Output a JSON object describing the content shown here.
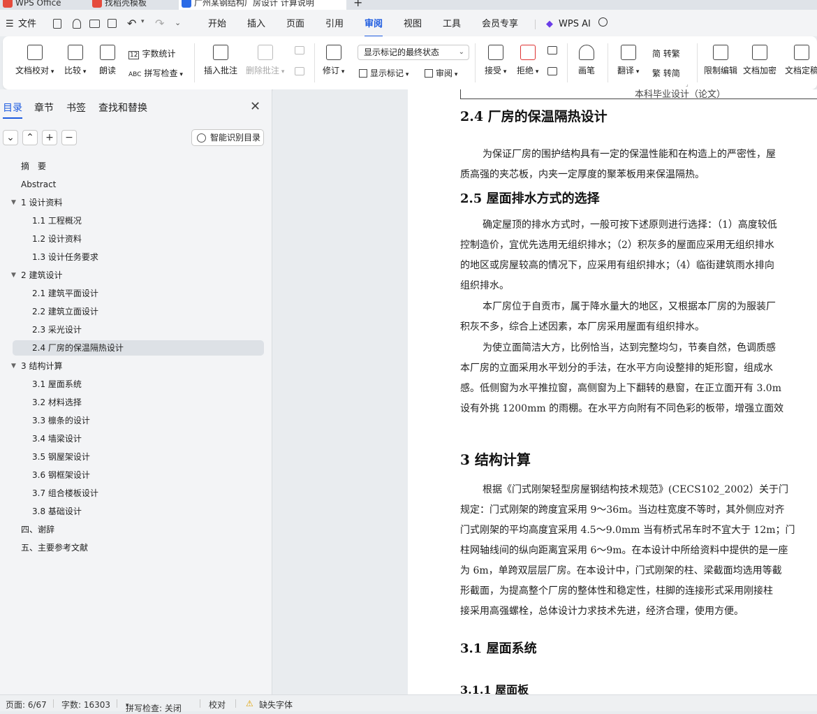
{
  "tabs": [
    {
      "label": "WPS Office",
      "color": "#e54b3c"
    },
    {
      "label": "找稻壳模板",
      "color": "#e54b3c"
    },
    {
      "label": "广州某钢结构厂房设计 计算说明",
      "color": "#2b6be6"
    }
  ],
  "menubar": {
    "hamburger": "☰",
    "file": "文件",
    "items": [
      "开始",
      "插入",
      "页面",
      "引用",
      "审阅",
      "视图",
      "工具",
      "会员专享"
    ],
    "active": "审阅",
    "ai": "WPS AI"
  },
  "ribbon": {
    "doc_proofread": "文档校对",
    "compare": "比较",
    "read_aloud": "朗读",
    "word_count": "字数统计",
    "spell_check": "拼写检查",
    "insert_comment": "插入批注",
    "delete_comment": "删除批注",
    "revise": "修订",
    "show_markup_dropdown": "显示标记的最终状态",
    "show_markup": "显示标记",
    "review": "审阅",
    "accept": "接受",
    "reject": "拒绝",
    "pen": "画笔",
    "translate": "翻译",
    "to_traditional": "简 转繁",
    "to_simplified": "繁 转简",
    "restrict_edit": "限制编辑",
    "doc_encrypt": "文档加密",
    "doc_finalize": "文档定稿"
  },
  "sidebar": {
    "tabs": [
      "目录",
      "章节",
      "书签",
      "查找和替换"
    ],
    "active_tab": "目录",
    "smart_toc": "智能识别目录",
    "toc": [
      {
        "label": "摘　要",
        "level": 1
      },
      {
        "label": "Abstract",
        "level": 1
      },
      {
        "label": "1 设计资料",
        "level": 1,
        "expanded": true
      },
      {
        "label": "1.1 工程概况",
        "level": 2
      },
      {
        "label": "1.2 设计资料",
        "level": 2
      },
      {
        "label": "1.3 设计任务要求",
        "level": 2
      },
      {
        "label": "2 建筑设计",
        "level": 1,
        "expanded": true
      },
      {
        "label": "2.1 建筑平面设计",
        "level": 2
      },
      {
        "label": "2.2 建筑立面设计",
        "level": 2
      },
      {
        "label": "2.3  采光设计",
        "level": 2
      },
      {
        "label": "2.4  厂房的保温隔热设计",
        "level": 2,
        "selected": true
      },
      {
        "label": "3 结构计算",
        "level": 1,
        "expanded": true
      },
      {
        "label": "3.1 屋面系统",
        "level": 2
      },
      {
        "label": "3.2 材料选择",
        "level": 2
      },
      {
        "label": "3.3 檩条的设计",
        "level": 2
      },
      {
        "label": "3.4  墙梁设计",
        "level": 2
      },
      {
        "label": "3.5  钢屋架设计",
        "level": 2
      },
      {
        "label": "3.6 钢框架设计",
        "level": 2
      },
      {
        "label": "3.7 组合楼板设计",
        "level": 2
      },
      {
        "label": "3.8 基础设计",
        "level": 2
      },
      {
        "label": "四、谢辞",
        "level": 1
      },
      {
        "label": "五、主要参考文献",
        "level": 1
      }
    ]
  },
  "document": {
    "header": "本科毕业设计（论文）",
    "heading_marker": "H₂",
    "h_2_4": "2.4  厂房的保温隔热设计",
    "p1": "为保证厂房的围护结构具有一定的保温性能和在构造上的严密性，屋",
    "p1b": "质高强的夹芯板，内夹一定厚度的聚苯板用来保温隔热。",
    "h_2_5": "2.5 屋面排水方式的选择",
    "p2a": "确定屋顶的排水方式时，一般可按下述原则进行选择：（1）高度较低",
    "p2b": "控制造价，宜优先选用无组织排水；（2）积灰多的屋面应采用无组织排水",
    "p2c": "的地区或房屋较高的情况下，应采用有组织排水；（4）临街建筑雨水排向",
    "p2d": "组织排水。",
    "p3a": "本厂房位于自贡市，属于降水量大的地区，又根据本厂房的为服装厂",
    "p3b": "积灰不多，综合上述因素，本厂房采用屋面有组织排水。",
    "p4a": "为使立面简洁大方，比例恰当，达到完整均匀，节奏自然，色调质感",
    "p4b": "本厂房的立面采用水平划分的手法，在水平方向设整排的矩形窗，组成水",
    "p4c": "感。低侧窗为水平推拉窗，高侧窗为上下翻转的悬窗，在正立面开有 3.0m",
    "p4d": "设有外挑 1200mm 的雨棚。在水平方向附有不同色彩的板带，增强立面效",
    "h_3": "3 结构计算",
    "p5a": "根据《门式刚架轻型房屋钢结构技术规范》(CECS102_2002）关于门",
    "p5b": "规定：门式刚架的跨度宜采用 9～36m。当边柱宽度不等时，其外侧应对齐",
    "p5c": "门式刚架的平均高度宜采用 4.5～9.0mm  当有桥式吊车时不宜大于 12m；门",
    "p5d": "柱网轴线间的纵向距离宜采用 6～9m。在本设计中所给资料中提供的是一座",
    "p5e": "为 6m，单跨双层层厂房。在本设计中，门式刚架的柱、梁截面均选用等截",
    "p5f": "形截面，为提高整个厂房的整体性和稳定性，柱脚的连接形式采用刚接柱",
    "p5g": "接采用高强螺栓，总体设计力求技术先进，经济合理，使用方便。",
    "h_3_1": "3.1 屋面系统",
    "h_3_1_1": "3.1.1 屋面板"
  },
  "statusbar": {
    "page": "页面: 6/67",
    "words": "字数: 16303",
    "spell": "拼写检查: 关闭",
    "proof": "校对",
    "missing_font": "缺失字体"
  }
}
